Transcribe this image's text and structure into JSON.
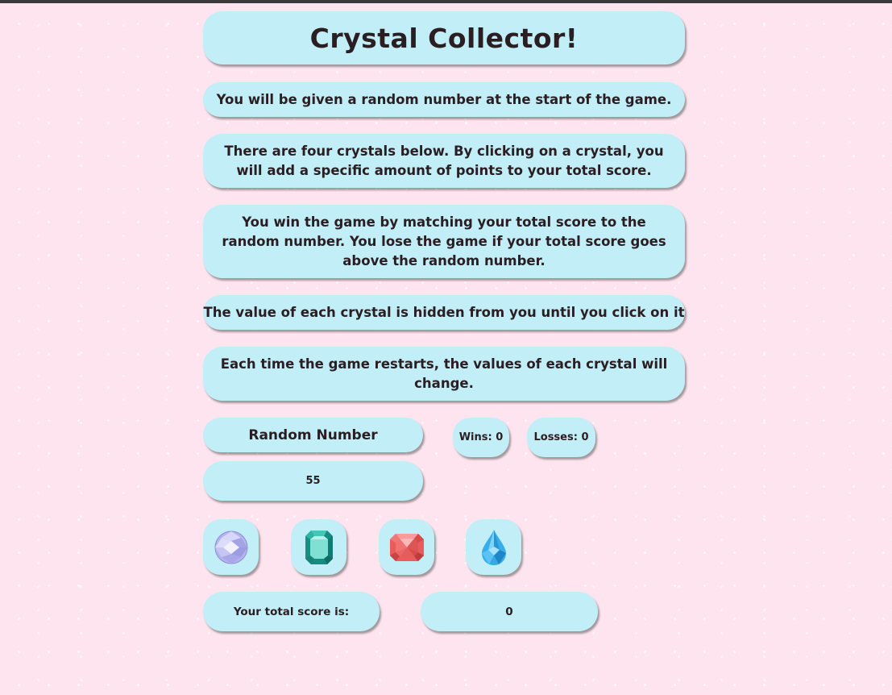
{
  "title": "Crystal Collector!",
  "instructions": [
    "You will be given a random number at the start of the game.",
    "There are four crystals below. By clicking on a crystal, you will add a specific amount of points to your total score.",
    "You win the game by matching your total score to the random number. You lose the game if your total score goes above the random number.",
    "The value of each crystal is hidden from you until you click on it",
    "Each time the game restarts, the values of each crystal will change."
  ],
  "random_number": {
    "label": "Random Number",
    "value": "55"
  },
  "stats": {
    "wins": "Wins: 0",
    "losses": "Losses: 0"
  },
  "crystals": [
    {
      "icon": "round-diamond-icon",
      "color": "#b6b6ef"
    },
    {
      "icon": "emerald-gem-icon",
      "color": "#1fa89a"
    },
    {
      "icon": "ruby-gem-icon",
      "color": "#ef6d6d"
    },
    {
      "icon": "water-drop-gem-icon",
      "color": "#3cb6ee"
    }
  ],
  "score": {
    "label": "Your total score is:",
    "value": "0"
  },
  "colors": {
    "background": "#fde4ee",
    "panel": "#c2eef7",
    "text": "#2a1e22"
  }
}
